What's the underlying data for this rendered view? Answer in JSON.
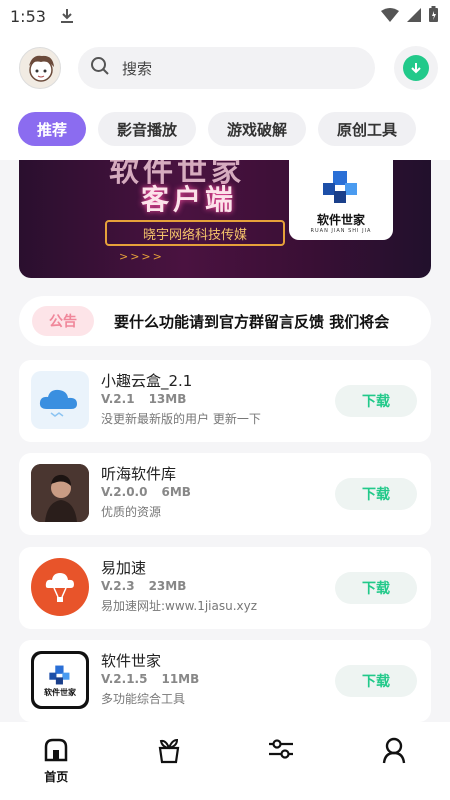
{
  "status_bar": {
    "time": "1:53"
  },
  "search": {
    "placeholder": "搜索"
  },
  "tabs": [
    {
      "label": "推荐",
      "active": true
    },
    {
      "label": "影音播放",
      "active": false
    },
    {
      "label": "游戏破解",
      "active": false
    },
    {
      "label": "原创工具",
      "active": false
    }
  ],
  "banner": {
    "top_text": "软件世家",
    "title": "客户端",
    "tagline": "晓宇网络科技传媒",
    "arrows": ">>>>",
    "logo_name": "软件世家",
    "logo_pinyin": "RUAN JIAN SHI JIA"
  },
  "notice": {
    "badge": "公告",
    "text": "要什么功能请到官方群留言反馈   我们将会"
  },
  "apps": [
    {
      "name": "小趣云盒_2.1",
      "version": "V.2.1",
      "size": "13MB",
      "desc": "没更新最新版的用户  更新一下",
      "button": "下载",
      "icon": "cloud-icon"
    },
    {
      "name": "听海软件库",
      "version": "V.2.0.0",
      "size": "6MB",
      "desc": "优质的资源",
      "button": "下载",
      "icon": "photo-avatar-icon"
    },
    {
      "name": "易加速",
      "version": "V.2.3",
      "size": "23MB",
      "desc": "易加速网址:www.1jiasu.xyz",
      "button": "下载",
      "icon": "balloon-icon"
    },
    {
      "name": "软件世家",
      "version": "V.2.1.5",
      "size": "11MB",
      "desc": "多功能综合工具",
      "button": "下载",
      "icon": "cube-logo-icon"
    }
  ],
  "bottom_nav": [
    {
      "label": "首页",
      "icon": "home-icon"
    },
    {
      "label": "",
      "icon": "apps-plant-icon"
    },
    {
      "label": "",
      "icon": "sliders-icon"
    },
    {
      "label": "",
      "icon": "user-icon"
    }
  ],
  "colors": {
    "accent": "#8b6cf0",
    "download_green": "#22c98a",
    "notice_pink": "#f0879a"
  }
}
